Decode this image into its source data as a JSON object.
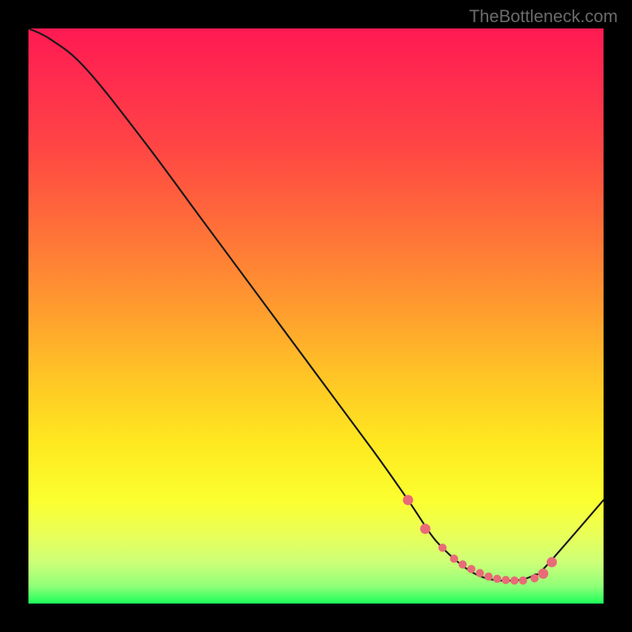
{
  "watermark": "TheBottleneck.com",
  "chart_data": {
    "type": "line",
    "title": "",
    "xlabel": "",
    "ylabel": "",
    "xlim": [
      0,
      100
    ],
    "ylim": [
      0,
      100
    ],
    "x": [
      0,
      4,
      10,
      20,
      30,
      40,
      50,
      60,
      66,
      70,
      72,
      74,
      76,
      78,
      80,
      82,
      84,
      86,
      88,
      90,
      100
    ],
    "values": [
      100,
      98,
      93,
      80.5,
      67,
      53.5,
      40,
      26.5,
      18,
      12,
      9.7,
      7.8,
      6.2,
      5.0,
      4.3,
      4.0,
      4.0,
      4.2,
      5.0,
      6.5,
      18
    ],
    "highlight_x": [
      66,
      69,
      72,
      74,
      75.5,
      77,
      78.5,
      80,
      81.5,
      83,
      84.5,
      86,
      88,
      89.5,
      91
    ],
    "highlight_y": [
      18,
      13,
      9.7,
      7.8,
      6.8,
      6.0,
      5.3,
      4.7,
      4.3,
      4.1,
      4.0,
      4.0,
      4.4,
      5.2,
      7.2
    ],
    "series_color": "#181818",
    "dot_color": "#e86b77",
    "gradient_colors": [
      "#ff1a52",
      "#ffe820",
      "#1dff5a"
    ]
  }
}
